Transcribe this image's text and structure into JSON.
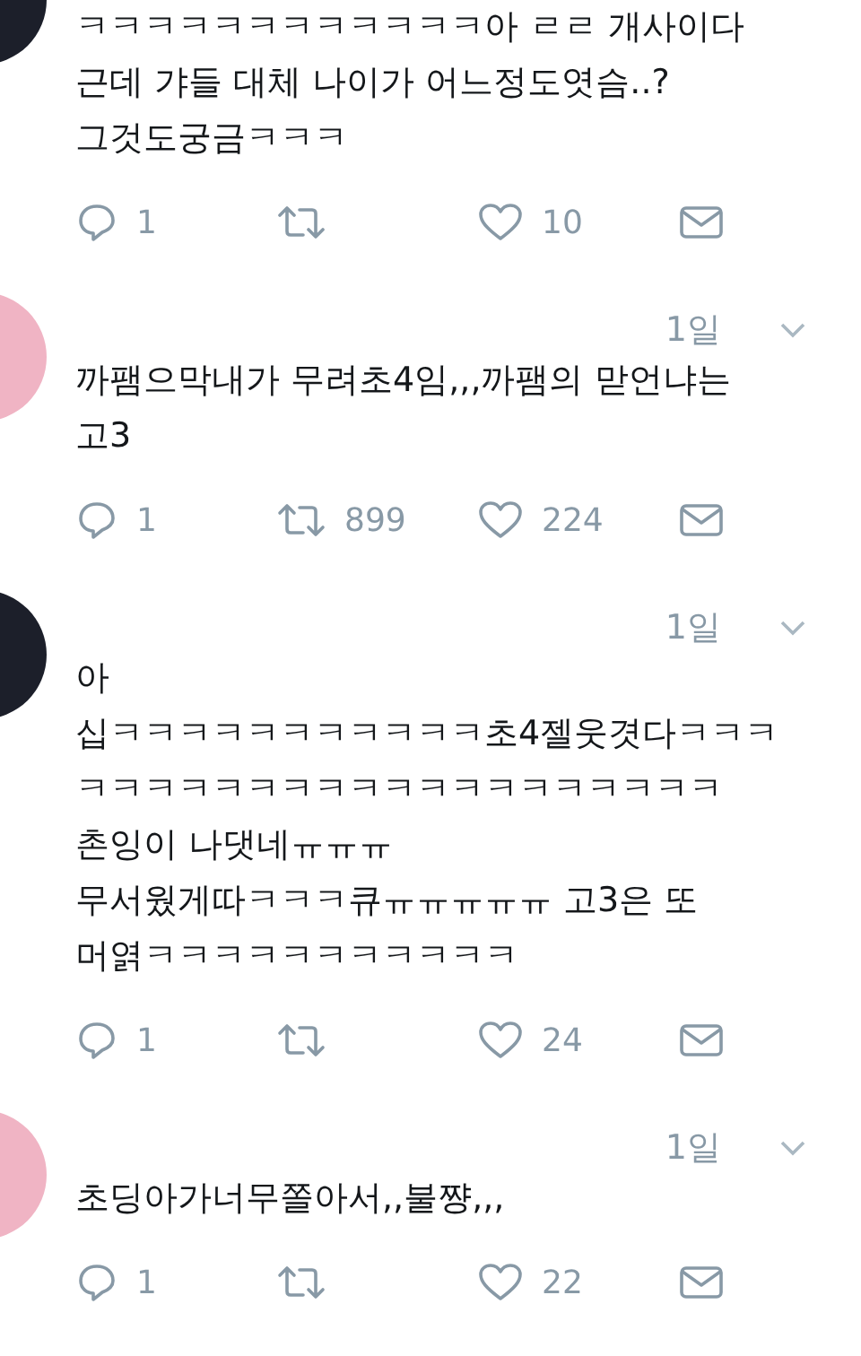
{
  "tweets": [
    {
      "avatar": {
        "color": "#1c1f2a"
      },
      "lines": [
        "ㅋㅋㅋㅋㅋㅋㅋㅋㅋㅋㅋㅋ아 ㄹㄹ 개사이다",
        "근데 갸들 대체 나이가 어느정도엿슴..?",
        "그것도궁금ㅋㅋㅋ"
      ],
      "replies": "1",
      "likes": "10"
    },
    {
      "avatar": {
        "color": "#f0b4c4"
      },
      "time": "1일",
      "lines": [
        "까팸으막내가 무려초4임,,,까팸의 맏언냐는",
        "고3"
      ],
      "replies": "1",
      "retweets": "899",
      "likes": "224"
    },
    {
      "avatar": {
        "color": "#1c1f2a"
      },
      "time": "1일",
      "lines": [
        "아",
        "십ㅋㅋㅋㅋㅋㅋㅋㅋㅋㅋㅋ초4젤웃겻다ㅋㅋㅋ",
        "ㅋㅋㅋㅋㅋㅋㅋㅋㅋㅋㅋㅋㅋㅋㅋㅋㅋㅋㅋ",
        "촌잉이 나댓네ㅠㅠㅠ",
        "무서웠게따ㅋㅋㅋ큐ㅠㅠㅠㅠㅠ 고3은 또",
        "머엵ㅋㅋㅋㅋㅋㅋㅋㅋㅋㅋㅋ"
      ],
      "replies": "1",
      "likes": "24"
    },
    {
      "avatar": {
        "color": "#f0b4c4"
      },
      "time": "1일",
      "lines": [
        "초딩아가너무쫄아서,,불쨩,,,"
      ],
      "replies": "1",
      "likes": "22"
    }
  ]
}
